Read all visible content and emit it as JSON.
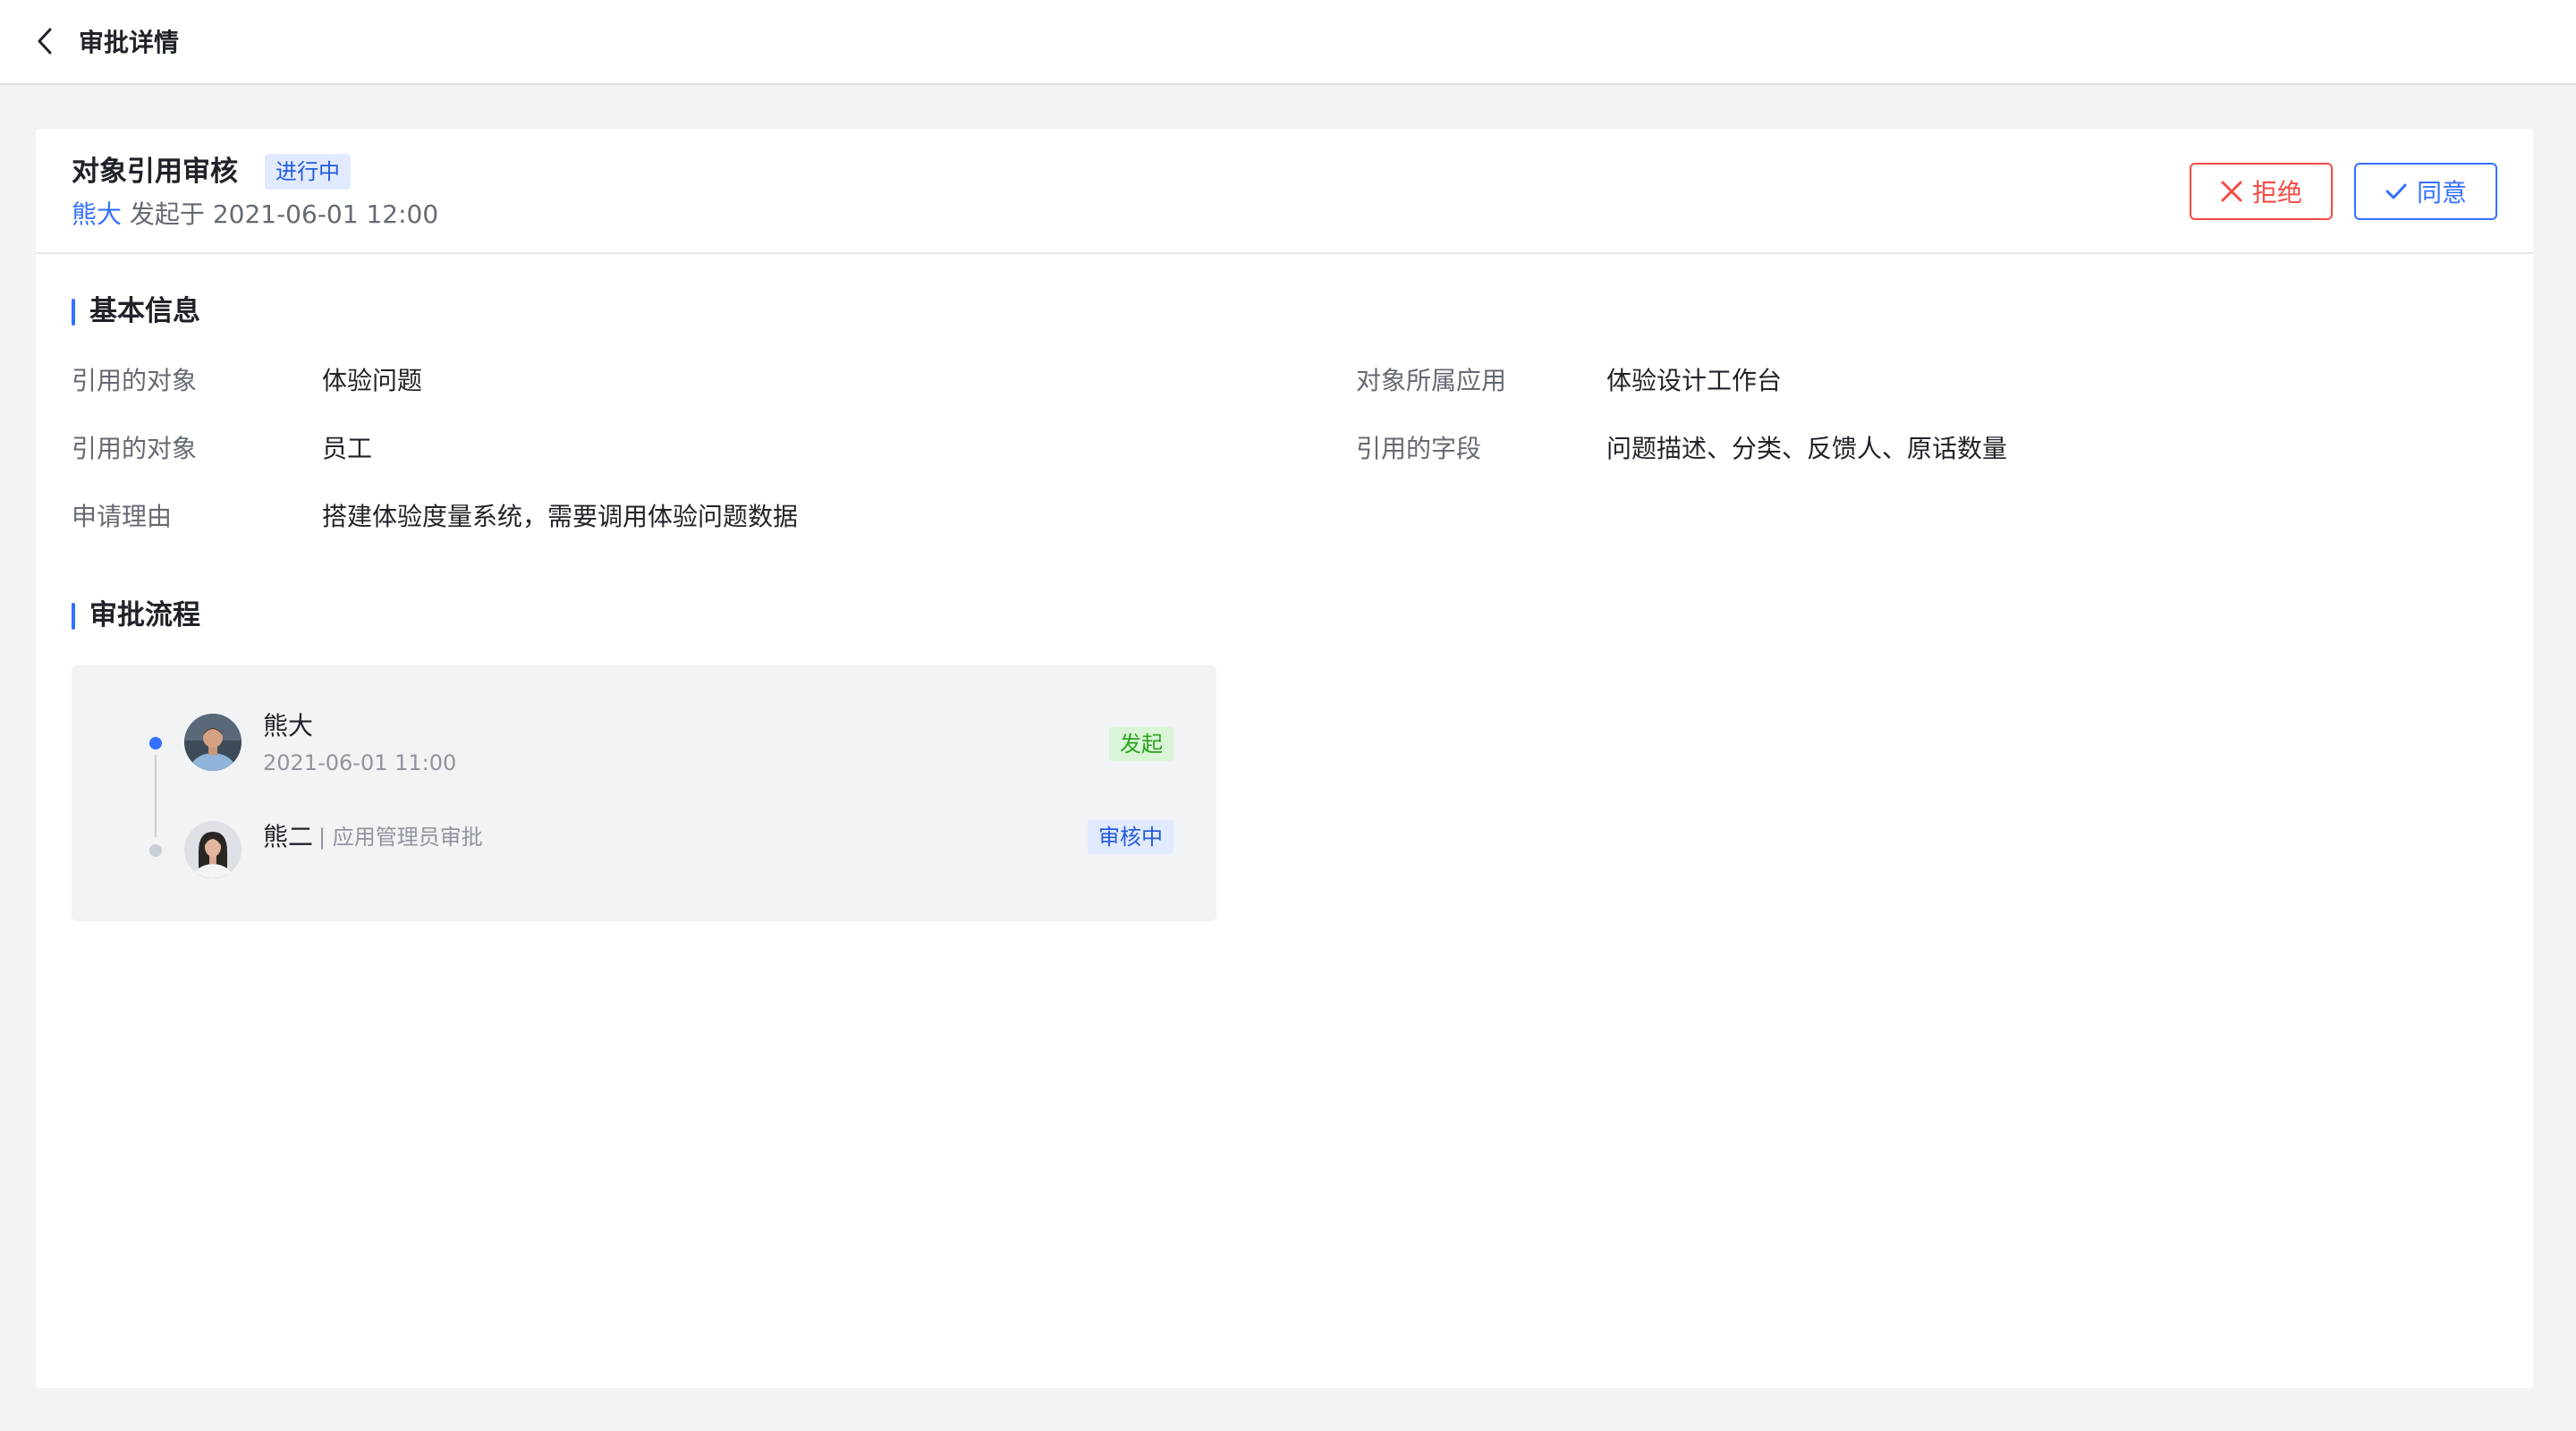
{
  "topbar": {
    "back_icon": "chevron-left-icon",
    "title": "审批详情"
  },
  "request": {
    "title": "对象引用审核",
    "status": "进行中",
    "initiator": "熊大",
    "initiated_text": "发起于 2021-06-01 12:00"
  },
  "actions": {
    "reject_label": "拒绝",
    "reject_icon": "close-icon",
    "approve_label": "同意",
    "approve_icon": "check-icon"
  },
  "basic_info": {
    "title": "基本信息",
    "rows": [
      {
        "label": "引用的对象",
        "value": "体验问题"
      },
      {
        "label": "对象所属应用",
        "value": "体验设计工作台"
      },
      {
        "label": "引用的对象",
        "value": "员工"
      },
      {
        "label": "引用的字段",
        "value": "问题描述、分类、反馈人、原话数量"
      },
      {
        "label": "申请理由",
        "value": "搭建体验度量系统，需要调用体验问题数据"
      }
    ]
  },
  "flow": {
    "title": "审批流程",
    "steps": [
      {
        "name": "熊大",
        "time": "2021-06-01 11:00",
        "tag": "发起",
        "avatar": "avatar-male"
      },
      {
        "name": "熊二",
        "role": "| 应用管理员审批",
        "tag": "审核中",
        "avatar": "avatar-female"
      }
    ]
  },
  "colors": {
    "primary": "#3370ff",
    "danger": "#f54a45",
    "success": "#2ea121",
    "background": "#f2f3f5"
  }
}
